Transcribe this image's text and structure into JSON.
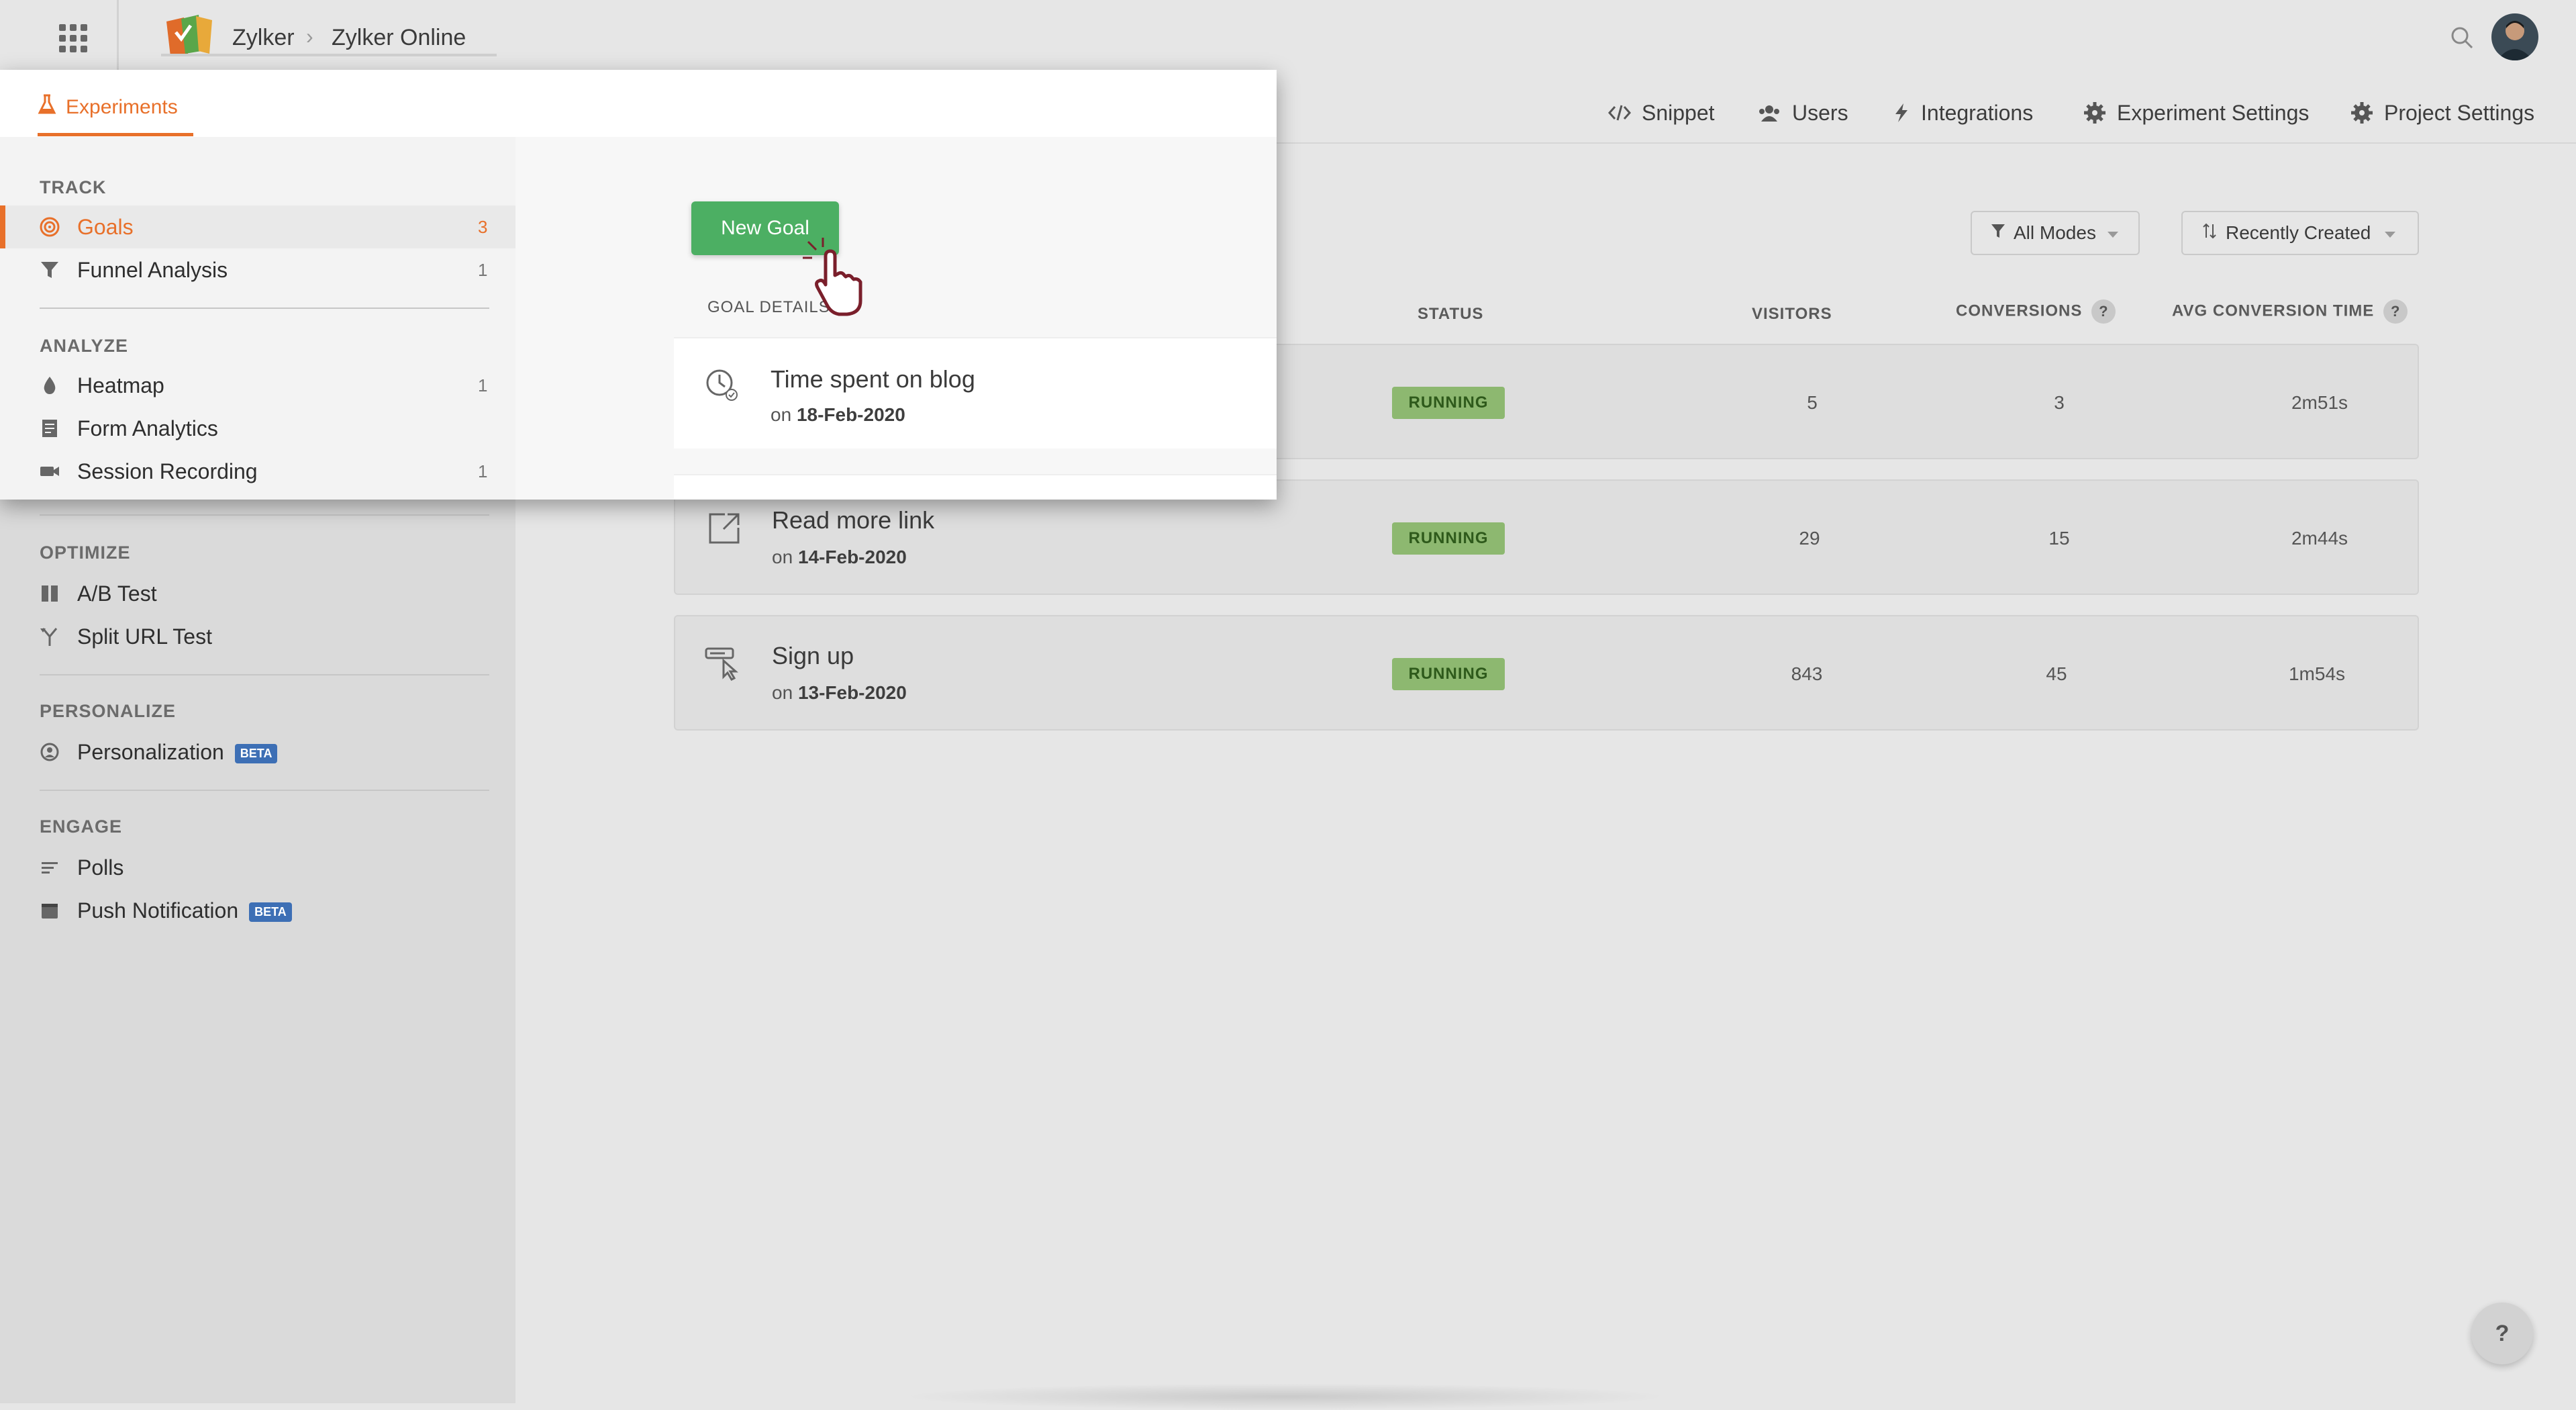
{
  "header": {
    "breadcrumb_org": "Zylker",
    "breadcrumb_sep": "›",
    "breadcrumb_project": "Zylker Online"
  },
  "topnav": [
    {
      "label": "Snippet",
      "icon": "code-icon"
    },
    {
      "label": "Users",
      "icon": "users-icon"
    },
    {
      "label": "Integrations",
      "icon": "bolt-icon"
    },
    {
      "label": "Experiment Settings",
      "icon": "gear-icon"
    },
    {
      "label": "Project Settings",
      "icon": "gear-icon"
    }
  ],
  "popup": {
    "tab_label": "Experiments",
    "new_goal_label": "New Goal",
    "goal_details_label": "GOAL DETAILS"
  },
  "sidebar": {
    "track": "TRACK",
    "analyze": "ANALYZE",
    "optimize": "OPTIMIZE",
    "personalize": "PERSONALIZE",
    "engage": "ENGAGE",
    "beta": "BETA",
    "items": {
      "goals": {
        "label": "Goals",
        "count": "3"
      },
      "funnel": {
        "label": "Funnel Analysis",
        "count": "1"
      },
      "heatmap": {
        "label": "Heatmap",
        "count": "1"
      },
      "form_analytics": {
        "label": "Form Analytics"
      },
      "session_recording": {
        "label": "Session Recording",
        "count": "1"
      },
      "ab_test": {
        "label": "A/B Test"
      },
      "split_url": {
        "label": "Split URL Test"
      },
      "personalization": {
        "label": "Personalization"
      },
      "polls": {
        "label": "Polls"
      },
      "push": {
        "label": "Push Notification"
      }
    }
  },
  "filters": {
    "mode": "All Modes",
    "sort": "Recently Created"
  },
  "columns": {
    "status": "STATUS",
    "visitors": "VISITORS",
    "conversions": "CONVERSIONS",
    "avg_time": "AVG CONVERSION TIME",
    "help": "?"
  },
  "goals": [
    {
      "title": "Time spent on blog",
      "date_prefix": "on",
      "date": "18-Feb-2020",
      "status": "RUNNING",
      "visitors": "5",
      "conversions": "3",
      "avg_time": "2m51s",
      "icon": "clock-icon"
    },
    {
      "title": "Read more link",
      "date_prefix": "on",
      "date": "14-Feb-2020",
      "status": "RUNNING",
      "visitors": "29",
      "conversions": "15",
      "avg_time": "2m44s",
      "icon": "external-link-icon"
    },
    {
      "title": "Sign up",
      "date_prefix": "on",
      "date": "13-Feb-2020",
      "status": "RUNNING",
      "visitors": "843",
      "conversions": "45",
      "avg_time": "1m54s",
      "icon": "signup-click-icon"
    }
  ],
  "help_button": "?"
}
